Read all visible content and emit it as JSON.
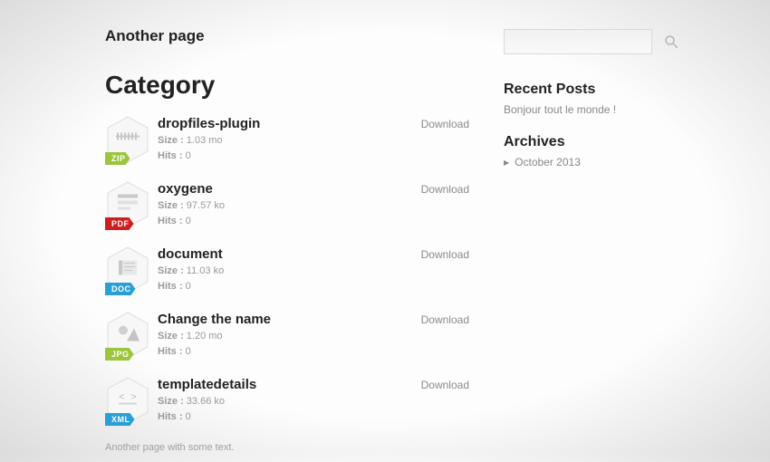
{
  "page": {
    "title": "Another page",
    "category_heading": "Category",
    "footer_text": "Another page with some text."
  },
  "labels": {
    "size": "Size :",
    "hits": "Hits :",
    "download": "Download"
  },
  "files": [
    {
      "name": "dropfiles-plugin",
      "size": "1.03 mo",
      "hits": "0",
      "type": "ZIP",
      "badge_color": "#9ac53c"
    },
    {
      "name": "oxygene",
      "size": "97.57 ko",
      "hits": "0",
      "type": "PDF",
      "badge_color": "#cc1f1f"
    },
    {
      "name": "document",
      "size": "11.03 ko",
      "hits": "0",
      "type": "DOC",
      "badge_color": "#2a9fd6"
    },
    {
      "name": "Change the name",
      "size": "1.20 mo",
      "hits": "0",
      "type": "JPG",
      "badge_color": "#9ac53c"
    },
    {
      "name": "templatedetails",
      "size": "33.66 ko",
      "hits": "0",
      "type": "XML",
      "badge_color": "#2a9fd6"
    }
  ],
  "sidebar": {
    "recent_posts_title": "Recent Posts",
    "recent_posts_item": "Bonjour tout le monde !",
    "archives_title": "Archives",
    "archives_item": "October 2013"
  },
  "search": {
    "placeholder": ""
  }
}
